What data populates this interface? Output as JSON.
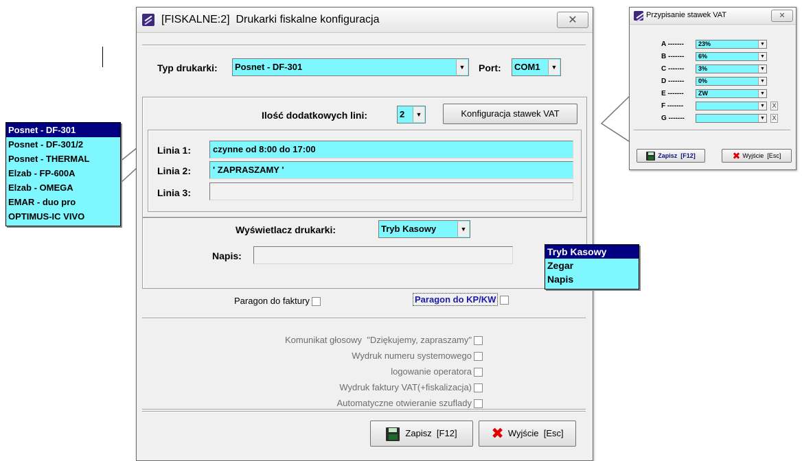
{
  "main_window": {
    "title": "[FISKALNE:2]  Drukarki fiskalne konfiguracja",
    "close_glyph": "✕",
    "printer_type_label": "Typ drukarki:",
    "printer_type_value": "Posnet - DF-301",
    "port_label": "Port:",
    "port_value": "COM1",
    "extra_lines_label": "Ilość dodatkowych lini:",
    "extra_lines_value": "2",
    "vat_config_button": "Konfiguracja stawek VAT",
    "lines": [
      {
        "label": "Linia 1:",
        "value": "czynne od 8:00 do 17:00"
      },
      {
        "label": "Linia 2:",
        "value": "' ZAPRASZAMY '"
      },
      {
        "label": "Linia 3:",
        "value": ""
      }
    ],
    "display_label": "Wyświetlacz drukarki:",
    "display_value": "Tryb Kasowy",
    "caption_label": "Napis:",
    "caption_value": "",
    "receipt_to_invoice_label": "Paragon do faktury",
    "receipt_to_kpkw_label": "Paragon do KP/KW",
    "options": [
      "Komunikat głosowy  \"Dziękujemy, zapraszamy\"",
      "Wydruk numeru systemowego",
      "logowanie operatora",
      "Wydruk faktury VAT(+fiskalizacja)",
      "Automatyczne otwieranie szuflady"
    ],
    "save_button": "Zapisz  [F12]",
    "exit_button": "Wyjście  [Esc]"
  },
  "printer_dropdown": {
    "items": [
      "Posnet - DF-301",
      "Posnet - DF-301/2",
      "Posnet - THERMAL",
      "Elzab - FP-600A",
      "Elzab - OMEGA",
      "EMAR - duo pro",
      "OPTIMUS-IC VIVO"
    ],
    "selected_index": 0
  },
  "display_dropdown": {
    "items": [
      "Tryb Kasowy",
      "Zegar",
      "Napis"
    ],
    "selected_index": 0
  },
  "vat_window": {
    "title": "Przypisanie stawek VAT",
    "close_glyph": "✕",
    "rates": [
      {
        "label": "A -------",
        "value": "23%"
      },
      {
        "label": "B -------",
        "value": "6%"
      },
      {
        "label": "C -------",
        "value": "3%"
      },
      {
        "label": "D -------",
        "value": "0%"
      },
      {
        "label": "E -------",
        "value": "ZW"
      },
      {
        "label": "F -------",
        "value": "",
        "clear": "X"
      },
      {
        "label": "G -------",
        "value": "",
        "clear": "X"
      }
    ],
    "save_button": "Zapisz  [F12]",
    "exit_button": "Wyjście  [Esc]"
  },
  "colors": {
    "field_cyan": "#7ff7ff",
    "selection": "#000080",
    "link_blue": "#1a1aa6",
    "close_red": "#e00000"
  }
}
